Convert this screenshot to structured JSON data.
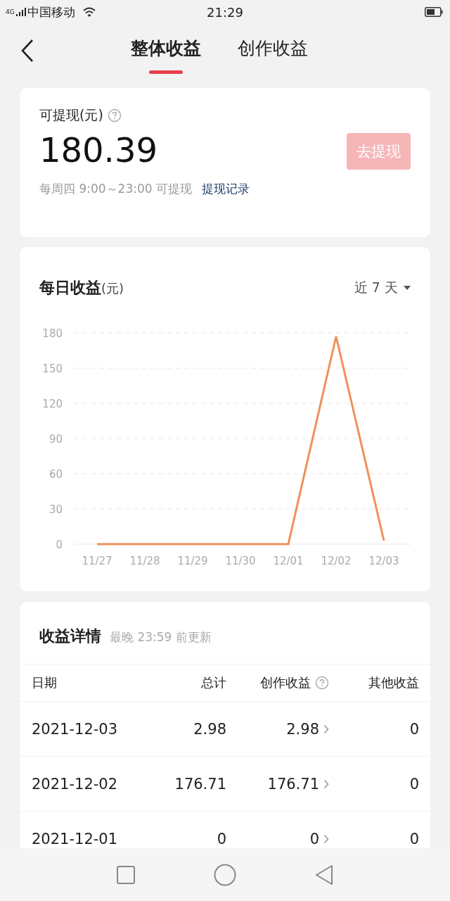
{
  "status_bar": {
    "network": "4G",
    "carrier": "中国移动",
    "time": "21:29"
  },
  "tabs": [
    {
      "label": "整体收益",
      "selected": true
    },
    {
      "label": "创作收益",
      "selected": false
    }
  ],
  "balance": {
    "label": "可提现(元)",
    "amount": "180.39",
    "button": "去提现",
    "button_disabled": true,
    "note": "每周四 9:00～23:00 可提现",
    "link": "提现记录"
  },
  "daily": {
    "title": "每日收益",
    "unit": "(元)",
    "range": "近 7 天",
    "chart_data": {
      "type": "line",
      "categories": [
        "11/27",
        "11/28",
        "11/29",
        "11/30",
        "12/01",
        "12/02",
        "12/03"
      ],
      "series": [
        {
          "color": "#f0905a",
          "values": [
            0,
            0,
            0,
            0,
            0,
            177,
            3
          ]
        }
      ],
      "grid": true,
      "ylim": [
        0,
        180
      ],
      "yticks": [
        0,
        30,
        60,
        90,
        120,
        150,
        180
      ]
    }
  },
  "details": {
    "title": "收益详情",
    "subtitle": "最晚 23:59 前更新",
    "columns": [
      "日期",
      "总计",
      "创作收益",
      "其他收益"
    ],
    "rows": [
      {
        "date": "2021-12-03",
        "total": "2.98",
        "creation": "2.98",
        "other": "0"
      },
      {
        "date": "2021-12-02",
        "total": "176.71",
        "creation": "176.71",
        "other": "0"
      },
      {
        "date": "2021-12-01",
        "total": "0",
        "creation": "0",
        "other": "0"
      }
    ]
  }
}
